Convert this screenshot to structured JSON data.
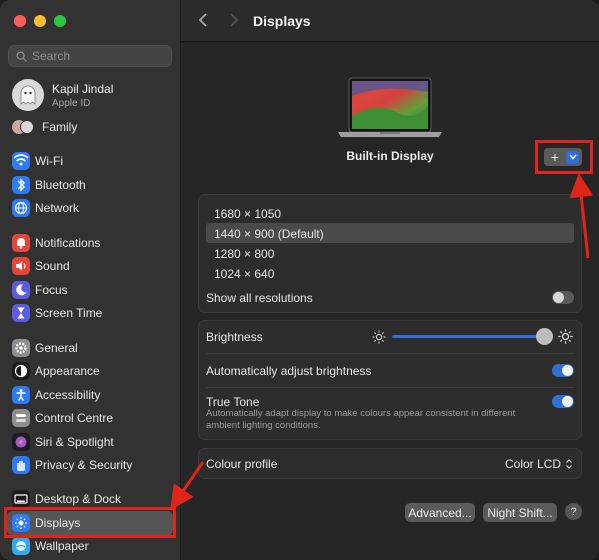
{
  "window": {
    "title": "Displays"
  },
  "search": {
    "placeholder": "Search"
  },
  "profile": {
    "name": "Kapil Jindal",
    "subtitle": "Apple ID"
  },
  "sidebar": {
    "family": "Family",
    "items": [
      {
        "label": "Wi-Fi",
        "icon": "wifi-icon",
        "color": "#2f7bf5"
      },
      {
        "label": "Bluetooth",
        "icon": "bluetooth-icon",
        "color": "#2f7bf5"
      },
      {
        "label": "Network",
        "icon": "globe-icon",
        "color": "#2f7bf5"
      },
      {
        "label": "Notifications",
        "icon": "bell-icon",
        "color": "#e6453c"
      },
      {
        "label": "Sound",
        "icon": "speaker-icon",
        "color": "#e6453c"
      },
      {
        "label": "Focus",
        "icon": "moon-icon",
        "color": "#5c5ce0"
      },
      {
        "label": "Screen Time",
        "icon": "hourglass-icon",
        "color": "#5c5ce0"
      },
      {
        "label": "General",
        "icon": "gear-icon",
        "color": "#8e8e93"
      },
      {
        "label": "Appearance",
        "icon": "appearance-icon",
        "color": "#1c1c1e"
      },
      {
        "label": "Accessibility",
        "icon": "accessibility-icon",
        "color": "#2f7bf5"
      },
      {
        "label": "Control Centre",
        "icon": "control-centre-icon",
        "color": "#8e8e93"
      },
      {
        "label": "Siri & Spotlight",
        "icon": "siri-icon",
        "color": "#1c1c1e"
      },
      {
        "label": "Privacy & Security",
        "icon": "hand-icon",
        "color": "#2f7bf5"
      },
      {
        "label": "Desktop & Dock",
        "icon": "dock-icon",
        "color": "#1c1c1e"
      },
      {
        "label": "Displays",
        "icon": "sun-icon",
        "color": "#2f7bf5"
      },
      {
        "label": "Wallpaper",
        "icon": "wallpaper-icon",
        "color": "#33aaf0"
      }
    ],
    "selected": "Displays"
  },
  "display": {
    "name": "Built-in Display",
    "add_symbol": "+",
    "resolutions": [
      "1680 × 1050",
      "1440 × 900 (Default)",
      "1280 × 800",
      "1024 × 640"
    ],
    "selected_resolution": "1440 × 900 (Default)",
    "show_all_label": "Show all resolutions",
    "show_all_on": false
  },
  "brightness": {
    "label": "Brightness",
    "level": 1.0,
    "auto_label": "Automatically adjust brightness",
    "auto_on": true,
    "true_tone_label": "True Tone",
    "true_tone_desc": "Automatically adapt display to make colours appear consistent in different ambient lighting conditions.",
    "true_tone_on": true
  },
  "colour_profile": {
    "label": "Colour profile",
    "value": "Color LCD"
  },
  "buttons": {
    "advanced": "Advanced...",
    "night_shift": "Night Shift...",
    "help": "?"
  },
  "colors": {
    "accent": "#2f6fd6",
    "annotation": "#e02419"
  }
}
